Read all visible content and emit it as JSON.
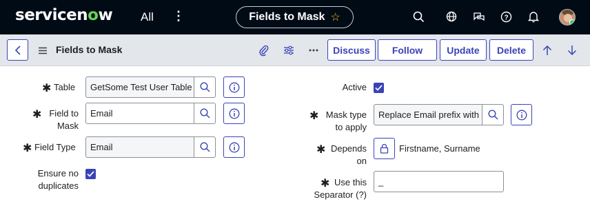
{
  "nav": {
    "brand_prefix": "servicen",
    "brand_o": "o",
    "brand_suffix": "w",
    "all_label": "All",
    "more_label": "⋮",
    "context_title": "Fields to Mask",
    "favorite_icon": "star-icon",
    "icons": [
      "search-icon",
      "globe-icon",
      "chat-icon",
      "help-icon",
      "bell-icon",
      "avatar"
    ]
  },
  "header": {
    "title": "Fields to Mask",
    "buttons": {
      "discuss": "Discuss",
      "follow": "Follow",
      "update": "Update",
      "delete": "Delete"
    },
    "icons": [
      "back-icon",
      "menu-icon",
      "attachment-icon",
      "settings-icon",
      "more-icon",
      "up-arrow-icon",
      "down-arrow-icon"
    ]
  },
  "form": {
    "left": {
      "table_label": "Table",
      "table_value": "GetSome Test User Table",
      "field_label_1": "Field to",
      "field_label_2": "Mask",
      "field_value": "Email",
      "field_type_label": "Field Type",
      "field_type_value": "Email",
      "ensure_label_1": "Ensure no",
      "ensure_label_2": "duplicates",
      "ensure_checked": true
    },
    "right": {
      "active_label": "Active",
      "active_checked": true,
      "mask_type_label_1": "Mask type",
      "mask_type_label_2": "to apply",
      "mask_type_value": "Replace Email prefix with",
      "depends_label_1": "Depends",
      "depends_label_2": "on",
      "depends_value": "Firstname, Surname",
      "separator_label_1": "Use this",
      "separator_label_2": "Separator (?)",
      "separator_value": "_"
    },
    "required_mark": "✱"
  },
  "colors": {
    "nav_bg": "#010b16",
    "brand_accent": "#62d84e",
    "primary": "#3943b7",
    "header_bg": "#e3e6ea"
  }
}
